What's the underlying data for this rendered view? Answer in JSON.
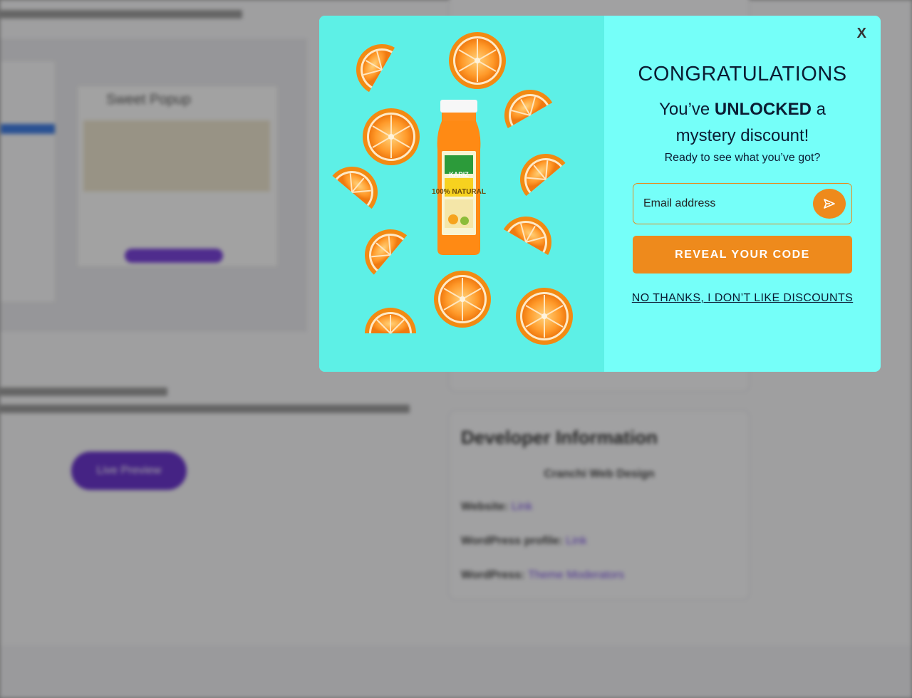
{
  "background": {
    "live_preview_label": "Live Preview",
    "mini_popup_title": "Sweet Popup",
    "developer": {
      "title": "Developer Information",
      "name": "Cranchi Web Design",
      "website_label": "Website:",
      "website_link": "Link",
      "profile_label": "WordPress profile:",
      "profile_link": "Link",
      "wp_label": "WordPress:",
      "wp_link": "Theme Moderators"
    }
  },
  "popup": {
    "close_label": "X",
    "headline": "CONGRATULATIONS",
    "sub_prefix": "You’ve ",
    "sub_strong": "UNLOCKED",
    "sub_suffix": " a",
    "sub_line2": "mystery discount!",
    "question": "Ready to see what you’ve got?",
    "email_placeholder": "Email address",
    "reveal_button": "REVEAL YOUR CODE",
    "decline_link": "NO THANKS, I DON’T LIKE DISCOUNTS",
    "product_label": "100% NATURAL",
    "brand": "KARIZ"
  },
  "colors": {
    "popup_bg": "#75fff9",
    "image_bg": "#5df0e6",
    "accent": "#ee8a1c",
    "text": "#0b1d33"
  }
}
